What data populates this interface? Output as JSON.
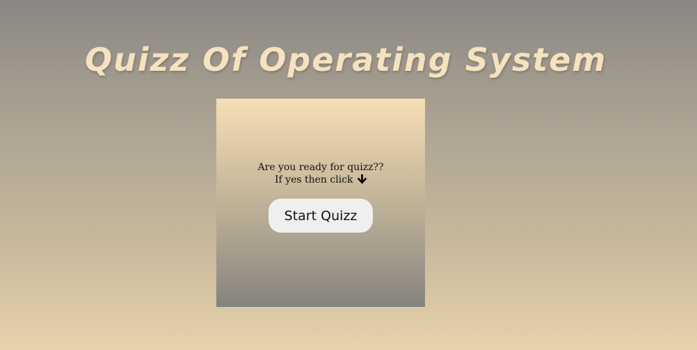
{
  "header": {
    "title": "Quizz Of Operating System"
  },
  "card": {
    "prompt_line1": "Are you ready for quizz??",
    "prompt_line2": "If yes then click",
    "arrow_icon": "arrow-down-icon",
    "start_label": "Start Quizz"
  }
}
